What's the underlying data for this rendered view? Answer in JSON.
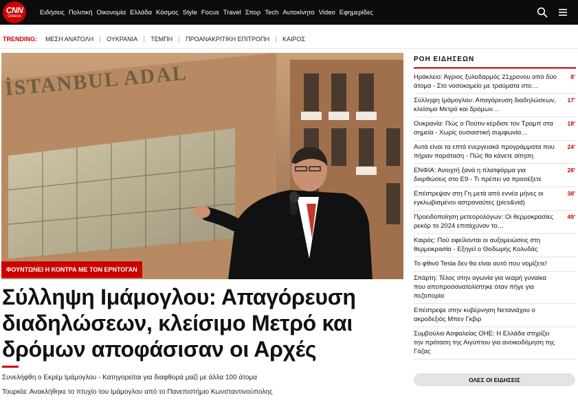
{
  "logo": {
    "main": "CNN",
    "sub": "Greece"
  },
  "nav": [
    "Ειδήσεις",
    "Πολιτική",
    "Οικονομία",
    "Ελλάδα",
    "Κόσμος",
    "Style",
    "Focus",
    "Travel",
    "Σπορ",
    "Tech",
    "Αυτοκίνητο",
    "Video",
    "Εφημερίδες"
  ],
  "icons": {
    "search": "search-icon",
    "menu": "menu-icon"
  },
  "trending": {
    "label": "TRENDING:",
    "items": [
      "ΜΕΣΗ ΑΝΑΤΟΛΗ",
      "ΟΥΚΡΑΝΙΑ",
      "ΤΕΜΠΗ",
      "ΠΡΟΑΝΑΚΡΙΤΙΚΗ ΕΠΙΤΡΟΠΗ",
      "ΚΑΙΡΟΣ"
    ]
  },
  "hero": {
    "building_text": "İSTANBUL ADAL",
    "tag": "ΦΟΥΝΤΩΝΕΙ Η ΚΟΝΤΡΑ ΜΕ ΤΟΝ ΕΡΝΤΟΓΑΝ",
    "headline_lines": [
      "Σύλληψη Ιμάμογλου: Απαγόρευση",
      "διαδηλώσεων, κλείσιμο Μετρό και",
      "δρόμων αποφάσισαν οι Αρχές"
    ],
    "related": [
      "Συνελήφθη ο Εκρέμ Ιμάμογλου - Κατηγορείται για διαφθορά μαζί με άλλα 100 άτομα",
      "Τουρκία: Ανακλήθηκε το πτυχίο του Ιμάμογλου από το Πανεπιστήμιο Κωνσταντινούπολης"
    ]
  },
  "feed": {
    "title": "ΡΟΗ ΕΙΔΗΣΕΩΝ",
    "items": [
      {
        "text": "Ηράκλειο: Άγριος ξυλοδαρμός 21χρονου από δύο άτομα - Στο νοσοκομείο με τραύματα στο…",
        "time": "8'"
      },
      {
        "text": "Σύλληψη Ιμάμογλου: Απαγόρευση διαδηλώσεων, κλείσιμο Μετρό και δρόμων…",
        "time": "17'"
      },
      {
        "text": "Ουκρανία: Πώς ο Πούτιν κέρδισε τον Τραμπ στα σημεία - Χωρίς ουσιαστική συμφωνία…",
        "time": "18'"
      },
      {
        "text": "Αυτά είναι τα επτά ενεργειακά προγράμματα που πήραν παράταση - Πώς θα κάνετε αίτηση",
        "time": "24'"
      },
      {
        "text": "ΕΝΦΙΑ: Ανοιχτή ξανά η πλατφόρμα για διορθώσεις στο Ε9 - Τι πρέπει να προσέξετε",
        "time": "28'"
      },
      {
        "text": "Επέστρεψαν στη Γη μετά από εννέα μήνες οι εγκλωβισμένοι αστροναύτες (pics&vid)",
        "time": "38'"
      },
      {
        "text": "Προειδοποίηση μετεορολόγων: Οι θερμοκρασίες ρεκόρ το 2024 επιτάχυναν το…",
        "time": "49'"
      },
      {
        "text": "Καιρός: Πού οφείλονται οι αυξομειώσεις στη θερμοκρασία - Εξηγεί ο Θοδωρής Κολυδάς",
        "time": ""
      },
      {
        "text": "Το φθινό Tesla δεν θα είναι αυτό που νομίζετε!",
        "time": ""
      },
      {
        "text": "Σπάρτη: Τέλος στην αγωνία για νεαρή γυναίκα που αποπροσανατολίστηκε όταν πήγε για πεζοπορία",
        "time": ""
      },
      {
        "text": "Επέστρεψε στην κυβέρνηση Νετανιάχου ο ακροδεξιός Μπεν Γκβιρ",
        "time": ""
      },
      {
        "text": "Συμβούλιο Ασφαλείας ΟΗΕ: Η Ελλάδα στηρίζει την πρόταση της Αιγύπτου για ανοικοδόμηση της Γάζας",
        "time": ""
      }
    ],
    "all_button": "ΟΛΕΣ ΟΙ ΕΙΔΗΣΕΙΣ"
  },
  "colors": {
    "accent": "#cc0000",
    "topbar": "#0c0c0c"
  }
}
